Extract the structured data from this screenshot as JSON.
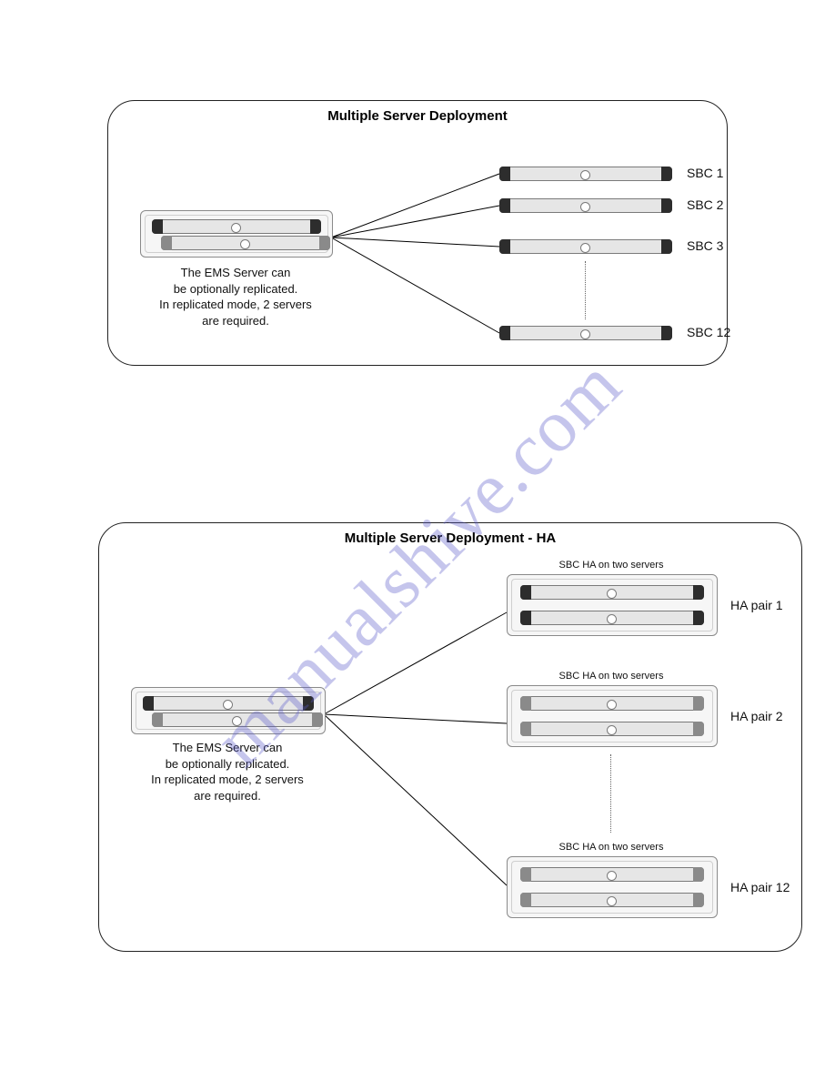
{
  "watermark": "manualshive.com",
  "panel1": {
    "title": "Multiple Server Deployment",
    "caption_line1": "The EMS Server can",
    "caption_line2": "be optionally replicated.",
    "caption_line3": "In replicated mode, 2 servers",
    "caption_line4": "are required.",
    "sbc1": "SBC 1",
    "sbc2": "SBC 2",
    "sbc3": "SBC 3",
    "sbc12": "SBC 12"
  },
  "panel2": {
    "title": "Multiple Server Deployment - HA",
    "caption_line1": "The EMS Server can",
    "caption_line2": "be optionally replicated.",
    "caption_line3": "In replicated mode, 2 servers",
    "caption_line4": "are required.",
    "box_label": "SBC HA on two servers",
    "pair1": "HA pair 1",
    "pair2": "HA pair 2",
    "pair12": "HA pair 12"
  }
}
